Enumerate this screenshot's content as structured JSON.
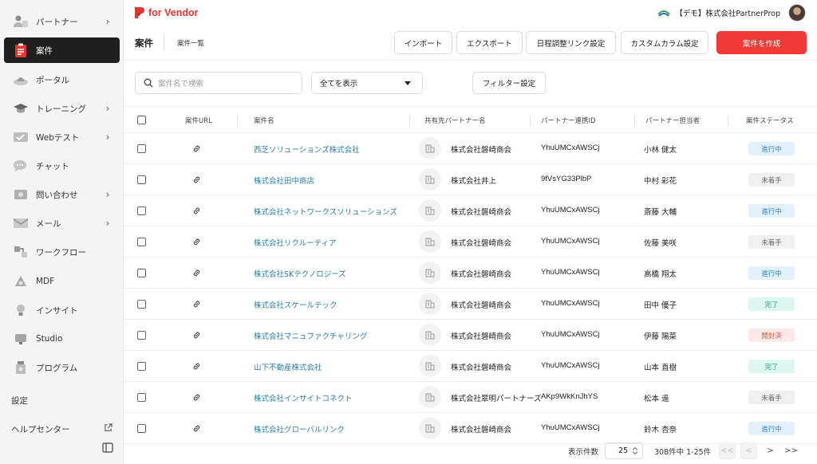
{
  "sidebar": {
    "items": [
      {
        "name": "partners",
        "label": "パートナー",
        "icon": "handshake-icon",
        "chev": true,
        "active": false
      },
      {
        "name": "cases",
        "label": "案件",
        "icon": "clipboard-icon",
        "chev": false,
        "active": true
      },
      {
        "name": "portal",
        "label": "ポータル",
        "icon": "portal-icon",
        "chev": false,
        "active": false
      },
      {
        "name": "training",
        "label": "トレーニング",
        "icon": "graduation-cap-icon",
        "chev": true,
        "active": false
      },
      {
        "name": "webtest",
        "label": "Webテスト",
        "icon": "test-icon",
        "chev": true,
        "active": false
      },
      {
        "name": "chat",
        "label": "チャット",
        "icon": "chat-icon",
        "chev": false,
        "active": false
      },
      {
        "name": "inquiry",
        "label": "問い合わせ",
        "icon": "inquiry-icon",
        "chev": true,
        "active": false
      },
      {
        "name": "mail",
        "label": "メール",
        "icon": "mail-icon",
        "chev": true,
        "active": false
      },
      {
        "name": "workflow",
        "label": "ワークフロー",
        "icon": "workflow-icon",
        "chev": false,
        "active": false
      },
      {
        "name": "mdf",
        "label": "MDF",
        "icon": "mdf-icon",
        "chev": false,
        "active": false
      },
      {
        "name": "insight",
        "label": "インサイト",
        "icon": "insight-icon",
        "chev": false,
        "active": false
      },
      {
        "name": "studio",
        "label": "Studio",
        "icon": "studio-icon",
        "chev": false,
        "active": false
      },
      {
        "name": "program",
        "label": "プログラム",
        "icon": "program-icon",
        "chev": false,
        "active": false
      }
    ],
    "settings": "設定",
    "help": "ヘルプセンター"
  },
  "brand": {
    "logo_text": "for Vendor",
    "accent": "#e8342e"
  },
  "header": {
    "org_name": "【デモ】株式会社PartnerProp"
  },
  "page": {
    "title": "案件",
    "subtitle": "案件一覧"
  },
  "toolbar": {
    "import": "インポート",
    "export": "エクスポート",
    "schedule": "日程調整リンク設定",
    "custom_column": "カスタムカラム設定",
    "create": "案件を作成"
  },
  "filters": {
    "search_placeholder": "案件名で検索",
    "scope": "全てを表示",
    "filter_settings": "フィルター設定"
  },
  "table": {
    "columns": [
      "案件URL",
      "案件名",
      "共有先パートナー名",
      "パートナー連携ID",
      "パートナー担当者",
      "案件ステータス"
    ],
    "rows": [
      {
        "name": "西芝ソリューションズ株式会社",
        "partner": "株式会社磐崎商会",
        "pid": "YhuUMCxAWSCj",
        "person": "小林 健太",
        "status": "進行中"
      },
      {
        "name": "株式会社田中商店",
        "partner": "株式会社井上",
        "pid": "9fVsYG33PlbP",
        "person": "中村 彩花",
        "status": "未着手"
      },
      {
        "name": "株式会社ネットワークスソリューションズ",
        "partner": "株式会社磐崎商会",
        "pid": "YhuUMCxAWSCj",
        "person": "斎藤 大輔",
        "status": "進行中"
      },
      {
        "name": "株式会社リクルーティア",
        "partner": "株式会社磐崎商会",
        "pid": "YhuUMCxAWSCj",
        "person": "佐藤 美咲",
        "status": "未着手"
      },
      {
        "name": "株式会社SKテクノロジーズ",
        "partner": "株式会社磐崎商会",
        "pid": "YhuUMCxAWSCj",
        "person": "高橋 翔太",
        "status": "進行中"
      },
      {
        "name": "株式会社スケールテック",
        "partner": "株式会社磐崎商会",
        "pid": "YhuUMCxAWSCj",
        "person": "田中 優子",
        "status": "完了"
      },
      {
        "name": "株式会社マニュファクチャリング",
        "partner": "株式会社磐崎商会",
        "pid": "YhuUMCxAWSCj",
        "person": "伊藤 陽菜",
        "status": "開封済"
      },
      {
        "name": "山下不動産株式会社",
        "partner": "株式会社磐崎商会",
        "pid": "YhuUMCxAWSCj",
        "person": "山本 直樹",
        "status": "完了"
      },
      {
        "name": "株式会社インサイトコネクト",
        "partner": "株式会社翠明パートナーズ",
        "pid": "AKp9WkKnJhYS",
        "person": "松本 遥",
        "status": "未着手"
      },
      {
        "name": "株式会社グローバルリンク",
        "partner": "株式会社磐崎商会",
        "pid": "YhuUMCxAWSCj",
        "person": "鈴木 杏奈",
        "status": "進行中"
      }
    ]
  },
  "status_colors": {
    "進行中": {
      "bg": "#e3f1fd",
      "fg": "#2f86d6"
    },
    "未着手": {
      "bg": "#f0f0f0",
      "fg": "#666666"
    },
    "完了": {
      "bg": "#ddf6ef",
      "fg": "#26a57c"
    },
    "開封済": {
      "bg": "#fde8e8",
      "fg": "#e0554e"
    }
  },
  "pagination": {
    "per_page_label": "表示件数",
    "per_page": "25",
    "range": "308件中 1-25件",
    "first": "<<",
    "prev": "<",
    "next": ">",
    "last": ">>"
  }
}
